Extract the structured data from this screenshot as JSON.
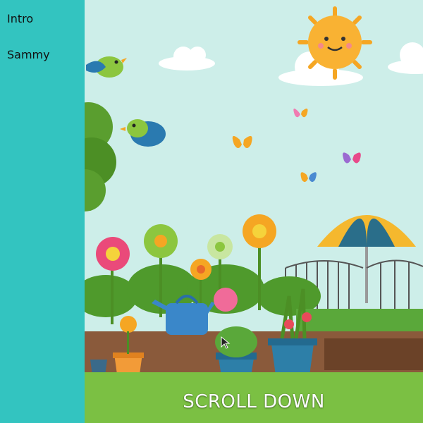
{
  "sidebar": {
    "items": [
      {
        "label": "Intro"
      },
      {
        "label": "Sammy"
      }
    ]
  },
  "hero": {
    "cta_label": "SCROLL DOWN",
    "illustration": "garden-illustration"
  },
  "colors": {
    "sidebar": "#33c4c0",
    "sky": "#cdeee9",
    "grass": "#7bc043",
    "soil": "#8a5a3b"
  }
}
